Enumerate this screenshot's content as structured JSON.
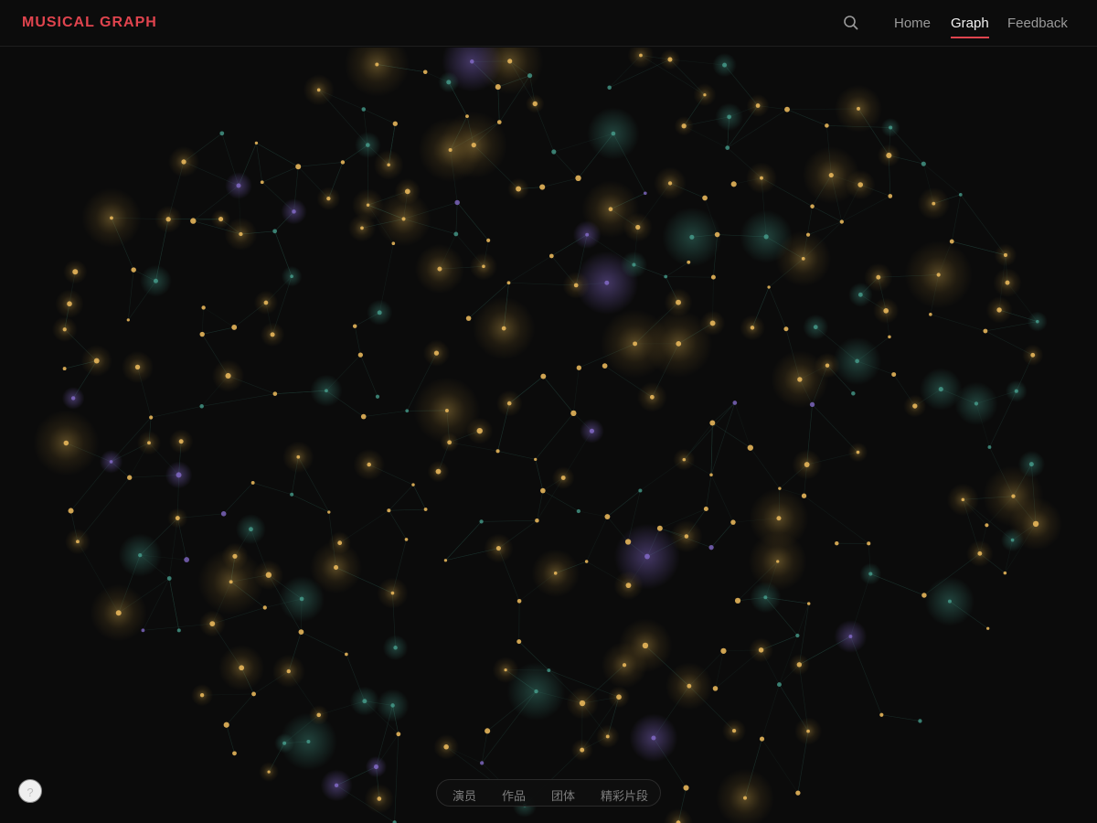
{
  "header": {
    "brand": "MUSICAL GRAPH",
    "nav": [
      "Home",
      "Graph",
      "Feedback"
    ],
    "active_nav": "Graph"
  },
  "legend": {
    "items": [
      "演员",
      "作品",
      "团体",
      "精彩片段"
    ]
  },
  "help": {
    "label": "?"
  },
  "colors": {
    "background": "#0b0b0b",
    "brand": "#e0444e",
    "actor_node": "#e6b55a",
    "work_node": "#4aa493",
    "group_node": "#8a6fd1",
    "edge": "#1f3a34"
  },
  "icons": {
    "search": "search-icon"
  }
}
